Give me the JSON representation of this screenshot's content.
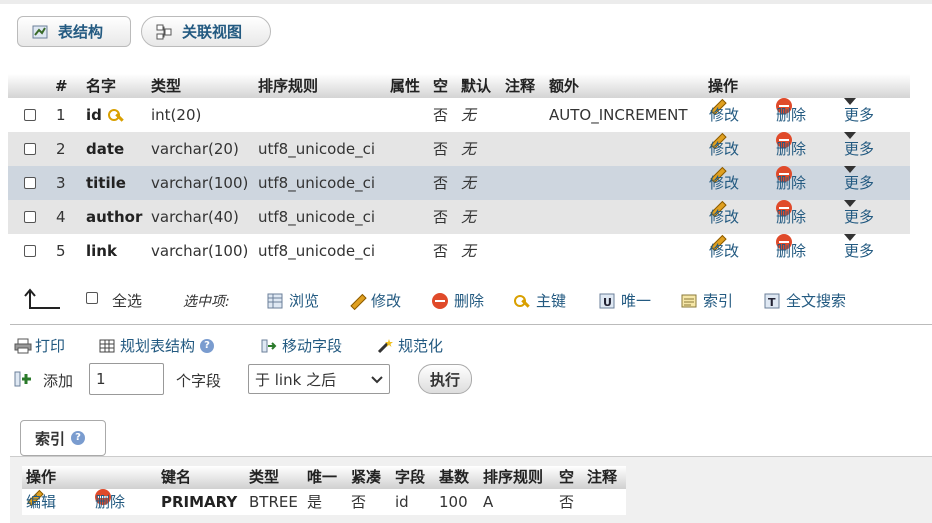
{
  "tabs": [
    {
      "label": "表结构",
      "icon": "structure-icon"
    },
    {
      "label": "关联视图",
      "icon": "relation-view-icon"
    }
  ],
  "table": {
    "headers": [
      "#",
      "名字",
      "类型",
      "排序规则",
      "属性",
      "空",
      "默认",
      "注释",
      "额外",
      "操作"
    ],
    "rows": [
      {
        "num": "1",
        "name": "id",
        "type": "int(20)",
        "collation": "",
        "null": "否",
        "default": "无",
        "extra": "AUTO_INCREMENT",
        "highlight": "none"
      },
      {
        "num": "2",
        "name": "date",
        "type": "varchar(20)",
        "collation": "utf8_unicode_ci",
        "null": "否",
        "default": "无",
        "extra": "",
        "highlight": "gray"
      },
      {
        "num": "3",
        "name": "titile",
        "type": "varchar(100)",
        "collation": "utf8_unicode_ci",
        "null": "否",
        "default": "无",
        "extra": "",
        "highlight": "hover"
      },
      {
        "num": "4",
        "name": "author",
        "type": "varchar(40)",
        "collation": "utf8_unicode_ci",
        "null": "否",
        "default": "无",
        "extra": "",
        "highlight": "gray"
      },
      {
        "num": "5",
        "name": "link",
        "type": "varchar(100)",
        "collation": "utf8_unicode_ci",
        "null": "否",
        "default": "无",
        "extra": "",
        "highlight": "none"
      }
    ],
    "actions": {
      "edit": "修改",
      "drop": "删除",
      "more": "更多"
    }
  },
  "bulk": {
    "select_all": "全选",
    "with_selected": "选中项:",
    "browse": "浏览",
    "edit": "修改",
    "drop": "删除",
    "primary": "主键",
    "unique": "唯一",
    "index": "索引",
    "fulltext": "全文搜索"
  },
  "tools": {
    "print": "打印",
    "propose": "规划表结构",
    "move": "移动字段",
    "normalize": "规范化",
    "add_label": "添加",
    "add_value": "1",
    "fields_label": "个字段",
    "position_selected": "于 link 之后",
    "go": "执行"
  },
  "indexes": {
    "legend": "索引",
    "headers": [
      "操作",
      "键名",
      "类型",
      "唯一",
      "紧凑",
      "字段",
      "基数",
      "排序规则",
      "空",
      "注释"
    ],
    "row": {
      "edit": "编辑",
      "drop": "删除",
      "keyname": "PRIMARY",
      "type": "BTREE",
      "unique": "是",
      "packed": "否",
      "column": "id",
      "cardinality": "100",
      "collation": "A",
      "null": "否",
      "comment": ""
    }
  },
  "colors": {
    "link": "#235a81",
    "row_gray": "#e5e5e5",
    "row_hover": "#ced6df",
    "drop_icon": "#e04a2a"
  }
}
